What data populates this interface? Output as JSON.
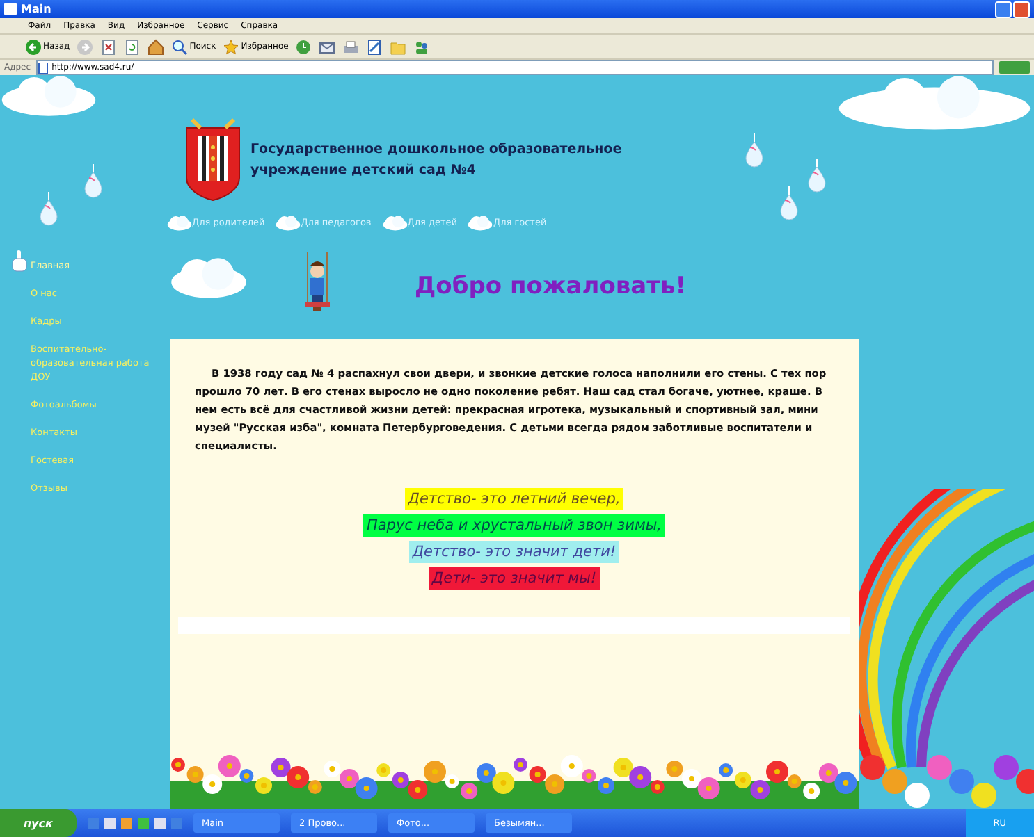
{
  "window": {
    "title": "Main"
  },
  "menu": [
    "Файл",
    "Правка",
    "Вид",
    "Избранное",
    "Сервис",
    "Справка"
  ],
  "toolbar": [
    {
      "kind": "back",
      "label": "Назад"
    },
    {
      "kind": "forward"
    },
    {
      "kind": "stop"
    },
    {
      "kind": "refresh"
    },
    {
      "kind": "home"
    },
    {
      "kind": "search",
      "label": "Поиск"
    },
    {
      "kind": "favorites",
      "label": "Избранное"
    },
    {
      "kind": "history"
    },
    {
      "kind": "mail"
    },
    {
      "kind": "print"
    },
    {
      "kind": "edit"
    },
    {
      "kind": "folder"
    },
    {
      "kind": "messenger"
    }
  ],
  "address": {
    "label": "Адрес",
    "value": "http://www.sad4.ru/"
  },
  "site": {
    "title": "Государственное дошкольное образовательное учреждение детский сад №4",
    "nav": [
      "Для родителей",
      "Для педагогов",
      "Для детей",
      "Для гостей"
    ],
    "menu": [
      {
        "label": "Главная",
        "selected": true
      },
      {
        "label": "О нас",
        "selected": false
      },
      {
        "label": "Кадры",
        "selected": false
      },
      {
        "label": "Воспитательно-образовательная работа ДОУ",
        "selected": false
      },
      {
        "label": "Фотоальбомы",
        "selected": false
      },
      {
        "label": "Контакты",
        "selected": false
      },
      {
        "label": "Гостевая",
        "selected": false
      },
      {
        "label": "Отзывы",
        "selected": false
      }
    ],
    "welcome": "Добро пожаловать!",
    "intro": "В 1938 году  сад № 4 распахнул свои двери, и звонкие детские голоса наполнили его стены. С тех пор прошло  70 лет. В его стенах выросло не одно поколение ребят. Наш сад стал богаче, уютнее, краше. В нем есть всё для счастливой жизни детей: прекрасная игротека, музыкальный и  спортивный зал, мини музей \"Русская изба\", комната Петербурговедения. С детьми всегда рядом заботливые воспитатели и специалисты.",
    "poem": [
      {
        "text": "Детство- это летний вечер,",
        "color": "#ffff00"
      },
      {
        "text": "Парус неба и хрустальный звон зимы,",
        "color": "#00ff44"
      },
      {
        "text": "Детство- это значит дети!",
        "color": "#a0eeee"
      },
      {
        "text": "Дети- это значит мы!",
        "color": "#f01838"
      }
    ]
  },
  "taskbar": {
    "start": "пуск",
    "tasks": [
      "Main",
      "2 Прово...",
      "Фото...",
      "Безымян..."
    ],
    "clock": "RU"
  }
}
